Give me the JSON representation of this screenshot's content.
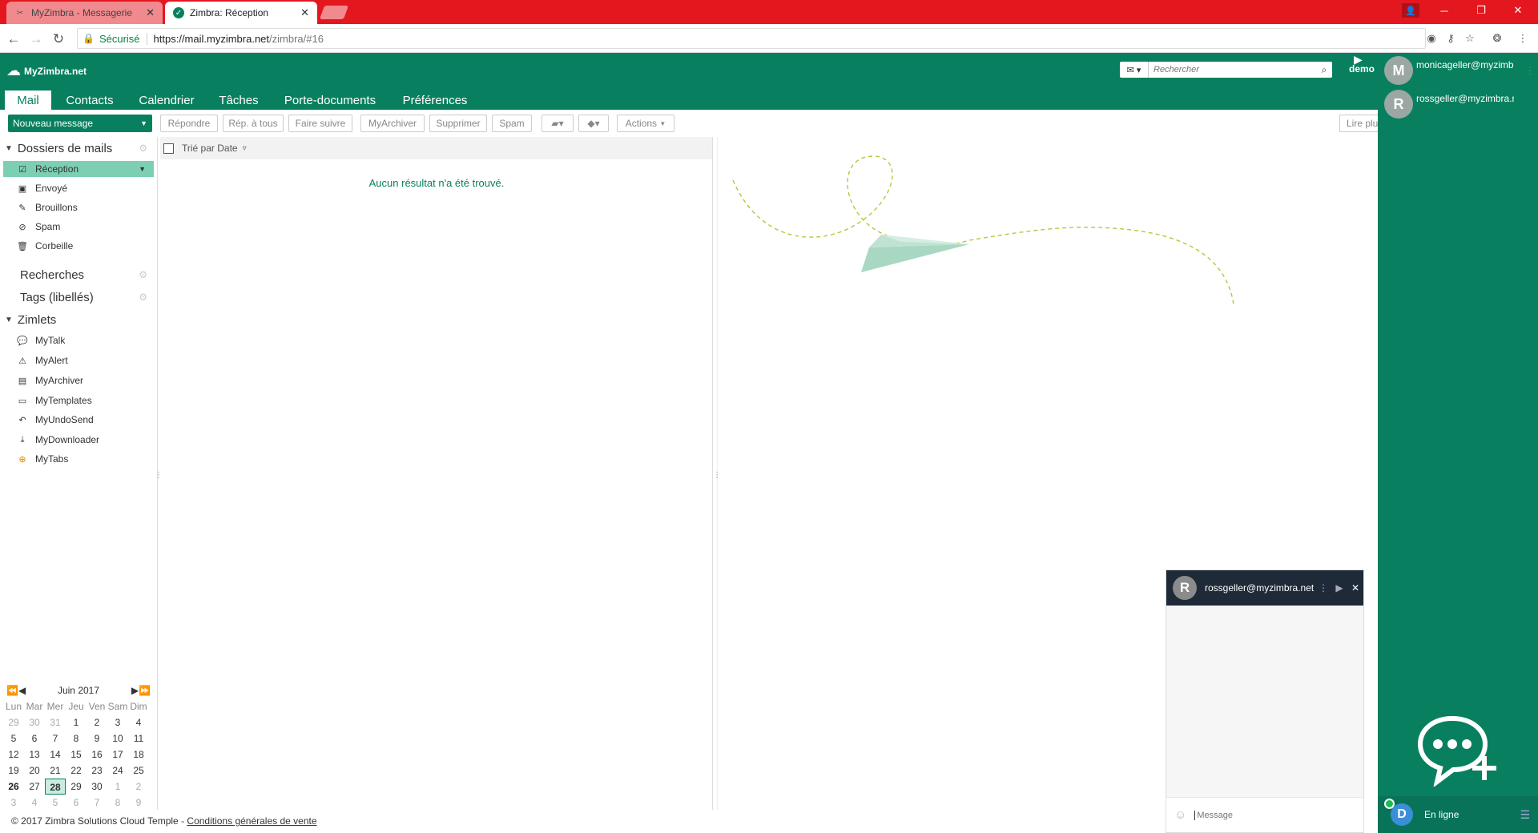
{
  "browser": {
    "tabs": [
      {
        "label": "MyZimbra - Messagerie",
        "active": false
      },
      {
        "label": "Zimbra: Réception",
        "active": true
      }
    ],
    "secure_label": "Sécurisé",
    "url_host": "https://mail.myzimbra.net",
    "url_path": "/zimbra/#16"
  },
  "header": {
    "logo_text": "MyZimbra.net",
    "tabs": [
      "Mail",
      "Contacts",
      "Calendrier",
      "Tâches",
      "Porte-documents",
      "Préférences"
    ],
    "search_placeholder": "Rechercher",
    "username": "demo"
  },
  "toolbar": {
    "new_message": "Nouveau message",
    "buttons": [
      "Répondre",
      "Rép. à tous",
      "Faire suivre",
      "MyArchiver",
      "Supprimer",
      "Spam",
      "Actions"
    ],
    "read_more": "Lire plus"
  },
  "sidebar": {
    "folders_title": "Dossiers de mails",
    "folders": [
      {
        "label": "Réception",
        "icon": "inbox-icon",
        "selected": true
      },
      {
        "label": "Envoyé",
        "icon": "sent-icon"
      },
      {
        "label": "Brouillons",
        "icon": "drafts-icon"
      },
      {
        "label": "Spam",
        "icon": "spam-icon"
      },
      {
        "label": "Corbeille",
        "icon": "trash-icon"
      }
    ],
    "searches_title": "Recherches",
    "tags_title": "Tags (libellés)",
    "zimlets_title": "Zimlets",
    "zimlets": [
      {
        "label": "MyTalk",
        "icon": "chat-bubble-icon"
      },
      {
        "label": "MyAlert",
        "icon": "alert-icon"
      },
      {
        "label": "MyArchiver",
        "icon": "archive-icon"
      },
      {
        "label": "MyTemplates",
        "icon": "template-icon"
      },
      {
        "label": "MyUndoSend",
        "icon": "undo-icon"
      },
      {
        "label": "MyDownloader",
        "icon": "download-icon"
      },
      {
        "label": "MyTabs",
        "icon": "add-circle-icon"
      }
    ]
  },
  "calendar": {
    "month": "Juin 2017",
    "weekdays": [
      "Lun",
      "Mar",
      "Mer",
      "Jeu",
      "Ven",
      "Sam",
      "Dim"
    ],
    "days": [
      [
        "29",
        "30",
        "31",
        "1",
        "2",
        "3",
        "4"
      ],
      [
        "5",
        "6",
        "7",
        "8",
        "9",
        "10",
        "11"
      ],
      [
        "12",
        "13",
        "14",
        "15",
        "16",
        "17",
        "18"
      ],
      [
        "19",
        "20",
        "21",
        "22",
        "23",
        "24",
        "25"
      ],
      [
        "26",
        "27",
        "28",
        "29",
        "30",
        "1",
        "2"
      ],
      [
        "3",
        "4",
        "5",
        "6",
        "7",
        "8",
        "9"
      ]
    ],
    "today": "28"
  },
  "list": {
    "sort_label": "Trié par Date",
    "empty_message": "Aucun résultat n'a été trouvé."
  },
  "chat_window": {
    "contact": "rossgeller@myzimbra.net",
    "avatar_letter": "R",
    "placeholder": "Message"
  },
  "chat_panel": {
    "contacts": [
      {
        "name": "monicageller@myzimbra.net",
        "letter": "M"
      },
      {
        "name": "rossgeller@myzimbra.net",
        "letter": "R"
      }
    ],
    "me_letter": "D",
    "status": "En ligne"
  },
  "footer": {
    "copyright": "© 2017 Zimbra Solutions Cloud Temple - ",
    "link": "Conditions générales de vente"
  },
  "colors": {
    "brand": "#08805f",
    "browser_red": "#e4171f",
    "selected_folder": "#7ccfb2"
  }
}
